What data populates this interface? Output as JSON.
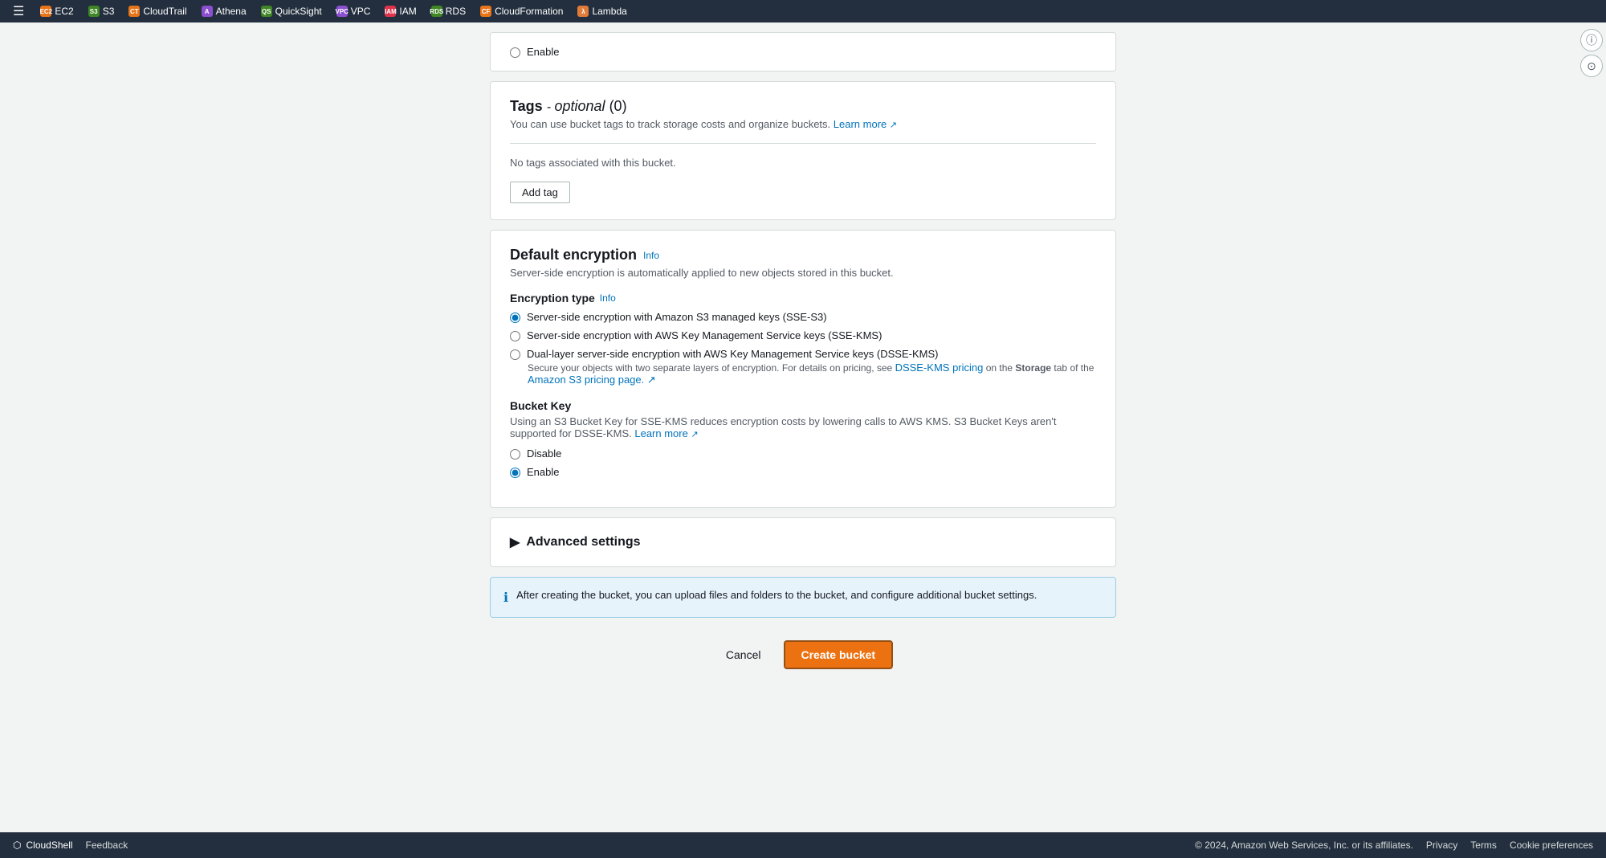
{
  "topnav": {
    "menu_icon": "☰",
    "items": [
      {
        "id": "ec2",
        "label": "EC2",
        "icon_class": "icon-ec2",
        "icon_text": "EC2"
      },
      {
        "id": "s3",
        "label": "S3",
        "icon_class": "icon-s3",
        "icon_text": "S3"
      },
      {
        "id": "cloudtrail",
        "label": "CloudTrail",
        "icon_class": "icon-cloudtrail",
        "icon_text": "CT"
      },
      {
        "id": "athena",
        "label": "Athena",
        "icon_class": "icon-athena",
        "icon_text": "A"
      },
      {
        "id": "quicksight",
        "label": "QuickSight",
        "icon_class": "icon-quicksight",
        "icon_text": "QS"
      },
      {
        "id": "vpc",
        "label": "VPC",
        "icon_class": "icon-vpc",
        "icon_text": "VPC"
      },
      {
        "id": "iam",
        "label": "IAM",
        "icon_class": "icon-iam",
        "icon_text": "IAM"
      },
      {
        "id": "rds",
        "label": "RDS",
        "icon_class": "icon-rds",
        "icon_text": "RDS"
      },
      {
        "id": "cloudformation",
        "label": "CloudFormation",
        "icon_class": "icon-cloudformation",
        "icon_text": "CF"
      },
      {
        "id": "lambda",
        "label": "Lambda",
        "icon_class": "icon-lambda",
        "icon_text": "λ"
      }
    ]
  },
  "partial_top": {
    "enable_label": "Enable"
  },
  "tags": {
    "title": "Tags",
    "optional_label": "optional",
    "count": "(0)",
    "description": "You can use bucket tags to track storage costs and organize buckets.",
    "learn_more": "Learn more",
    "no_tags_text": "No tags associated with this bucket.",
    "add_tag_btn": "Add tag"
  },
  "encryption": {
    "title": "Default encryption",
    "info_label": "Info",
    "description": "Server-side encryption is automatically applied to new objects stored in this bucket.",
    "field_label": "Encryption type",
    "field_info": "Info",
    "options": [
      {
        "id": "sse-s3",
        "label": "Server-side encryption with Amazon S3 managed keys (SSE-S3)",
        "checked": true,
        "has_sub": false
      },
      {
        "id": "sse-kms",
        "label": "Server-side encryption with AWS Key Management Service keys (SSE-KMS)",
        "checked": false,
        "has_sub": false
      },
      {
        "id": "dsse-kms",
        "label": "Dual-layer server-side encryption with AWS Key Management Service keys (DSSE-KMS)",
        "checked": false,
        "has_sub": true,
        "sub_text_before": "Secure your objects with two separate layers of encryption. For details on pricing, see ",
        "sub_bold": "DSSE-KMS pricing",
        "sub_text_mid": " on the ",
        "sub_bold2": "Storage",
        "sub_text_after": " tab of the",
        "sub_link": "Amazon S3 pricing page.",
        "sub_link_icon": "↗"
      }
    ],
    "bucket_key": {
      "title": "Bucket Key",
      "description": "Using an S3 Bucket Key for SSE-KMS reduces encryption costs by lowering calls to AWS KMS. S3 Bucket Keys aren't supported for DSSE-KMS.",
      "learn_more": "Learn more",
      "learn_more_icon": "↗",
      "disable_label": "Disable",
      "enable_label": "Enable",
      "enable_checked": true
    }
  },
  "advanced": {
    "toggle_label": "Advanced settings",
    "expand_icon": "▶"
  },
  "info_banner": {
    "icon": "ℹ",
    "text": "After creating the bucket, you can upload files and folders to the bucket, and configure additional bucket settings."
  },
  "actions": {
    "cancel_label": "Cancel",
    "create_label": "Create bucket"
  },
  "footer": {
    "cloudshell_icon": "⬡",
    "cloudshell_label": "CloudShell",
    "feedback_label": "Feedback",
    "copyright": "© 2024, Amazon Web Services, Inc. or its affiliates.",
    "privacy": "Privacy",
    "terms": "Terms",
    "cookie": "Cookie preferences"
  }
}
